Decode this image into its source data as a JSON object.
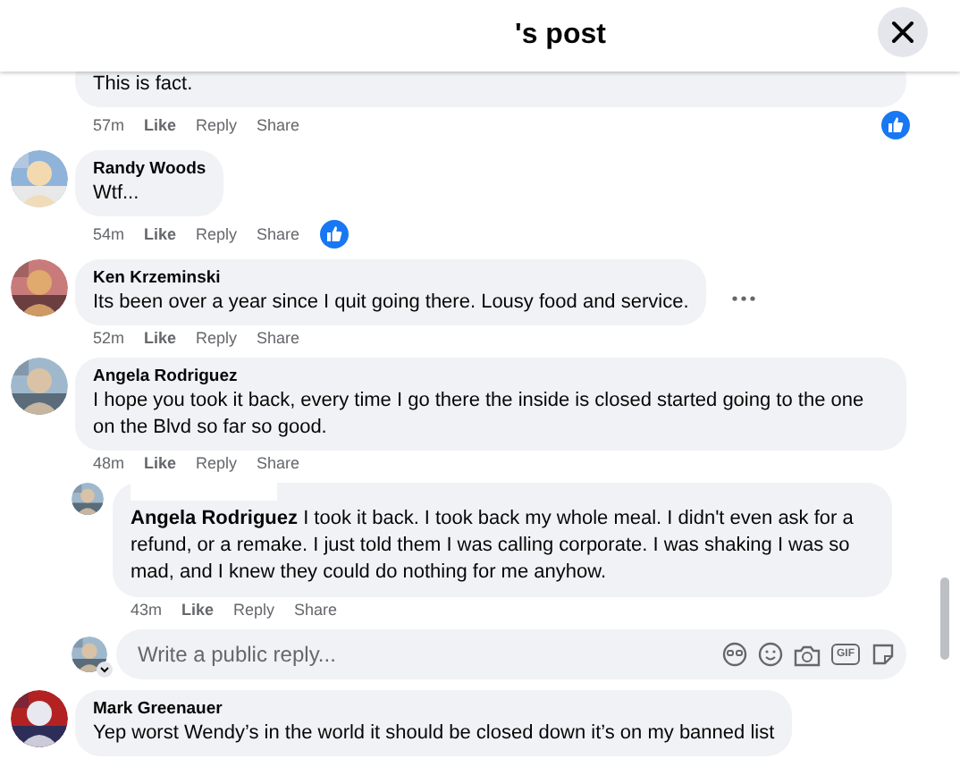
{
  "header": {
    "title": "'s post"
  },
  "comments": [
    {
      "text": "This is fact.",
      "time": "57m",
      "actions": [
        "Like",
        "Reply",
        "Share"
      ],
      "liked": true,
      "more": false
    },
    {
      "author": "Randy Woods",
      "text": "Wtf...",
      "time": "54m",
      "actions": [
        "Like",
        "Reply",
        "Share"
      ],
      "liked": true,
      "more": false
    },
    {
      "author": "Ken Krzeminski",
      "text": "Its been over a year since I quit going there. Lousy food and service.",
      "time": "52m",
      "actions": [
        "Like",
        "Reply",
        "Share"
      ],
      "liked": false,
      "more": true
    },
    {
      "author": "Angela Rodriguez",
      "text": "I hope you took it back, every time I go there the inside is closed started going to the one on the Blvd so far so good.",
      "time": "48m",
      "actions": [
        "Like",
        "Reply",
        "Share"
      ],
      "liked": false,
      "more": false,
      "replies": [
        {
          "text": "**Angela Rodriguez** I took it back. I took back my whole meal. I didn't even ask for a refund, or a remake. I just told them I was calling corporate. I was shaking I was so mad, and I knew they could do nothing for me anyhow.",
          "time": "43m",
          "actions": [
            "Like",
            "Reply",
            "Share"
          ],
          "liked": false,
          "more": false
        }
      ],
      "composer": {
        "placeholder": "Write a public reply...",
        "gif_label": "GIF"
      }
    },
    {
      "author": "Mark Greenauer",
      "text": "Yep worst Wendy’s in the world it should be closed down it’s on my banned list",
      "more": false
    }
  ]
}
